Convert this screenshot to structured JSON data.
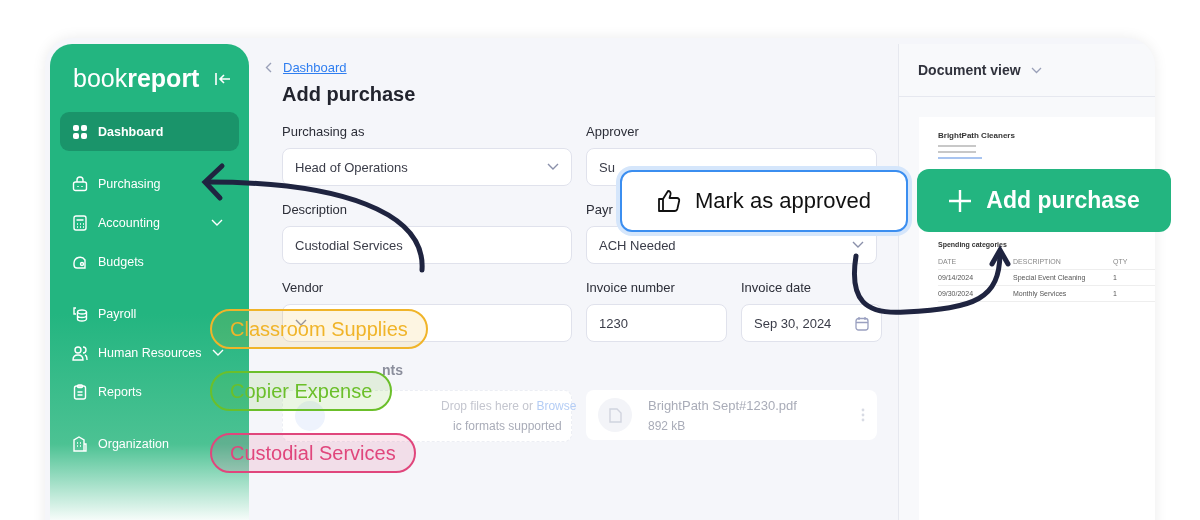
{
  "sidebar": {
    "logo": "book**report**",
    "groups": [
      [
        {
          "label": "Dashboard",
          "selected": true,
          "expandable": false
        }
      ],
      [
        {
          "label": "Purchasing",
          "selected": false,
          "expandable": false
        },
        {
          "label": "Accounting",
          "selected": false,
          "expandable": true
        },
        {
          "label": "Budgets",
          "selected": false,
          "expandable": false
        }
      ],
      [
        {
          "label": "Payroll",
          "selected": false,
          "expandable": false
        },
        {
          "label": "Human Resources",
          "selected": false,
          "expandable": true
        },
        {
          "label": "Reports",
          "selected": false,
          "expandable": false
        }
      ],
      [
        {
          "label": "Organization",
          "selected": false,
          "expandable": false
        }
      ]
    ]
  },
  "breadcrumb": {
    "link": "Dashboard"
  },
  "page_title": "Add purchase",
  "form_rows": [
    [
      {
        "label": "Purchasing as",
        "value": "Head of Operations",
        "kind": "select"
      },
      {
        "label": "Approver",
        "value": "Su",
        "kind": "text"
      }
    ],
    [
      {
        "label": "Description",
        "value": "Custodial Services",
        "kind": "text"
      },
      {
        "label": "Payr",
        "value": "ACH Needed",
        "kind": "select"
      }
    ],
    [
      {
        "label": "Vendor",
        "kind": "select"
      },
      {
        "label": "Invoice number",
        "value": "1230",
        "kind": "text"
      },
      {
        "label": "Invoice date",
        "value": "Sep 30, 2024",
        "kind": "date"
      }
    ]
  ],
  "attachments": {
    "label": "nts",
    "upload_text": "Drop files here or",
    "upload_link": "Browse",
    "upload_hint": "ic formats supported",
    "file": {
      "name": "BrightPath Sept#1230.pdf",
      "size": "892 kB"
    }
  },
  "document_view": {
    "title": "Document view",
    "company": "BrightPath Cleaners",
    "section": "Spending categories",
    "columns": [
      "DATE",
      "DESCRIPTION",
      "QTY"
    ],
    "rows": [
      [
        "09/14/2024",
        "Special Event Cleaning",
        "1"
      ],
      [
        "09/30/2024",
        "Monthly Services",
        "1"
      ]
    ]
  },
  "approve_button": "Mark as approved",
  "add_button": "Add purchase",
  "tags": [
    {
      "label": "Classroom Supplies",
      "color": "#f0b429"
    },
    {
      "label": "Copier Expense",
      "color": "#6bbf2a"
    },
    {
      "label": "Custodial Services",
      "color": "#e0467c"
    }
  ]
}
